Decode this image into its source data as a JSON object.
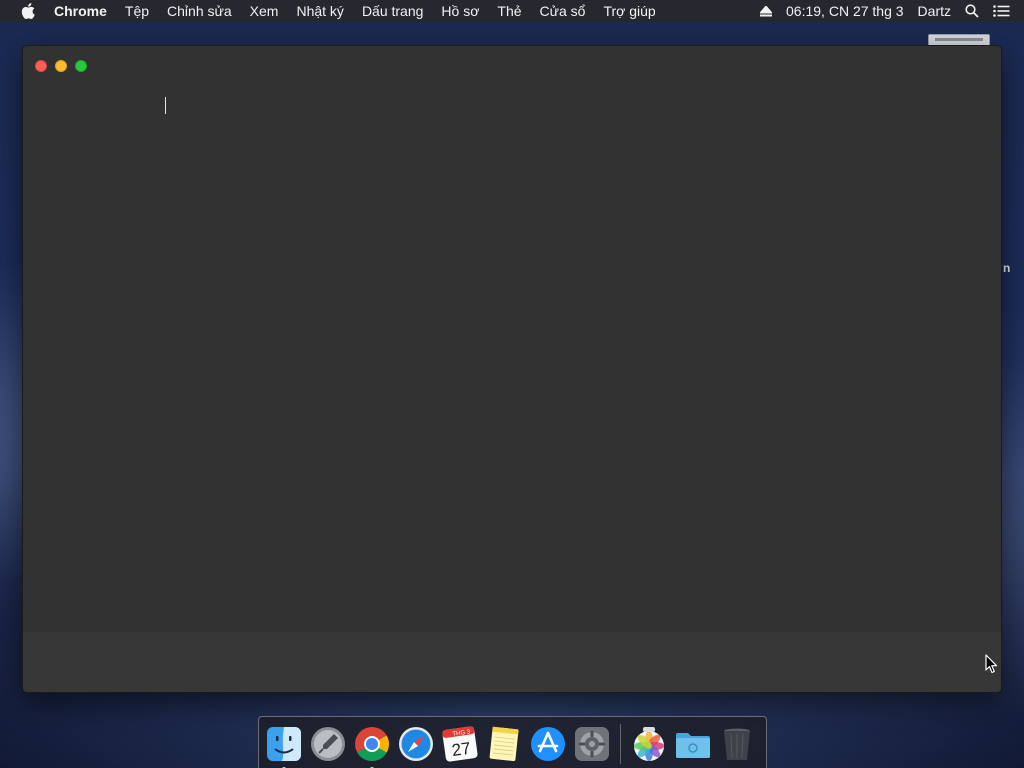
{
  "menubar": {
    "app_name": "Chrome",
    "items": [
      "Tệp",
      "Chỉnh sửa",
      "Xem",
      "Nhật ký",
      "Dấu trang",
      "Hồ sơ",
      "Thẻ",
      "Cửa sổ",
      "Trợ giúp"
    ],
    "clock": "06:19, CN 27 thg 3",
    "user": "Dartz"
  },
  "desktop": {
    "partial_label": "n"
  },
  "dock": {
    "icons": [
      "finder-icon",
      "launchpad-icon",
      "chrome-icon",
      "safari-icon",
      "calendar-icon",
      "notes-icon",
      "app-store-icon",
      "system-preferences-icon",
      "photos-icon",
      "folder-icon",
      "trash-icon"
    ],
    "calendar_month": "THG 3",
    "calendar_day": "27"
  },
  "colors": {
    "window_bg": "#323232",
    "close": "#ff5f57",
    "minimize": "#febc2e",
    "maximize": "#28c840"
  }
}
